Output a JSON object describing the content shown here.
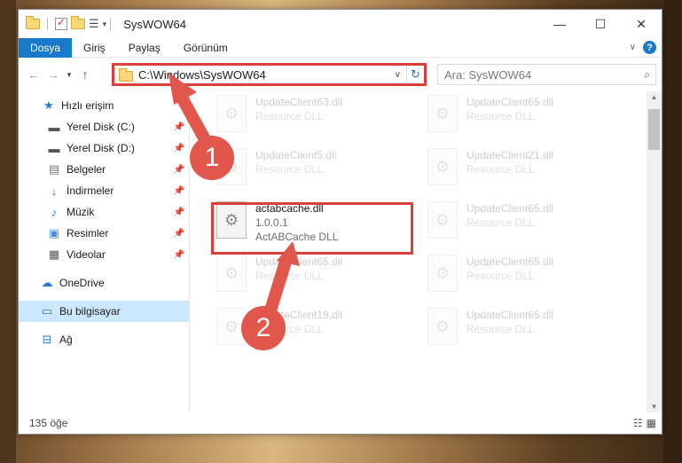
{
  "window": {
    "title": "SysWOW64"
  },
  "ribbon": {
    "tabs": [
      "Dosya",
      "Giriş",
      "Paylaş",
      "Görünüm"
    ]
  },
  "address": {
    "path": "C:\\Windows\\SysWOW64",
    "search_placeholder": "Ara: SysWOW64"
  },
  "nav": {
    "items": [
      {
        "label": "Hızlı erişim",
        "icon": "star-icon"
      },
      {
        "label": "Yerel Disk (C:)",
        "icon": "drive-icon"
      },
      {
        "label": "Yerel Disk (D:)",
        "icon": "drive-icon"
      },
      {
        "label": "Belgeler",
        "icon": "documents-icon"
      },
      {
        "label": "İndirmeler",
        "icon": "download-icon"
      },
      {
        "label": "Müzik",
        "icon": "music-icon"
      },
      {
        "label": "Resimler",
        "icon": "pictures-icon"
      },
      {
        "label": "Videolar",
        "icon": "videos-icon"
      },
      {
        "label": "OneDrive",
        "icon": "cloud-icon"
      },
      {
        "label": "Bu bilgisayar",
        "icon": "computer-icon"
      },
      {
        "label": "Ağ",
        "icon": "network-icon"
      }
    ]
  },
  "files": {
    "left": [
      {
        "name": "UpdateClient63.dll",
        "desc": "Resource DLL"
      },
      {
        "name": "UpdateClient5.dll",
        "desc": "Resource DLL"
      },
      {
        "name": "UpdateClient65.dll",
        "desc": "Resource DLL"
      },
      {
        "name": "UpdateClient19.dll",
        "desc": "Resource DLL"
      }
    ],
    "right": [
      {
        "name": "UpdateClient65.dll",
        "desc": "Resource DLL"
      },
      {
        "name": "UpdateClient21.dll",
        "desc": "Resource DLL"
      },
      {
        "name": "UpdateClient65.dll",
        "desc": "Resource DLL"
      },
      {
        "name": "UpdateClient65.dll",
        "desc": "Resource DLL"
      },
      {
        "name": "UpdateClient65.dll",
        "desc": "Resource DLL"
      }
    ],
    "highlighted": {
      "name": "actabcache.dll",
      "version": "1.0.0.1",
      "desc": "ActABCache DLL"
    }
  },
  "status": {
    "count": "135 öğe"
  },
  "annotations": {
    "step1": "1",
    "step2": "2",
    "color": "#e2574c"
  }
}
